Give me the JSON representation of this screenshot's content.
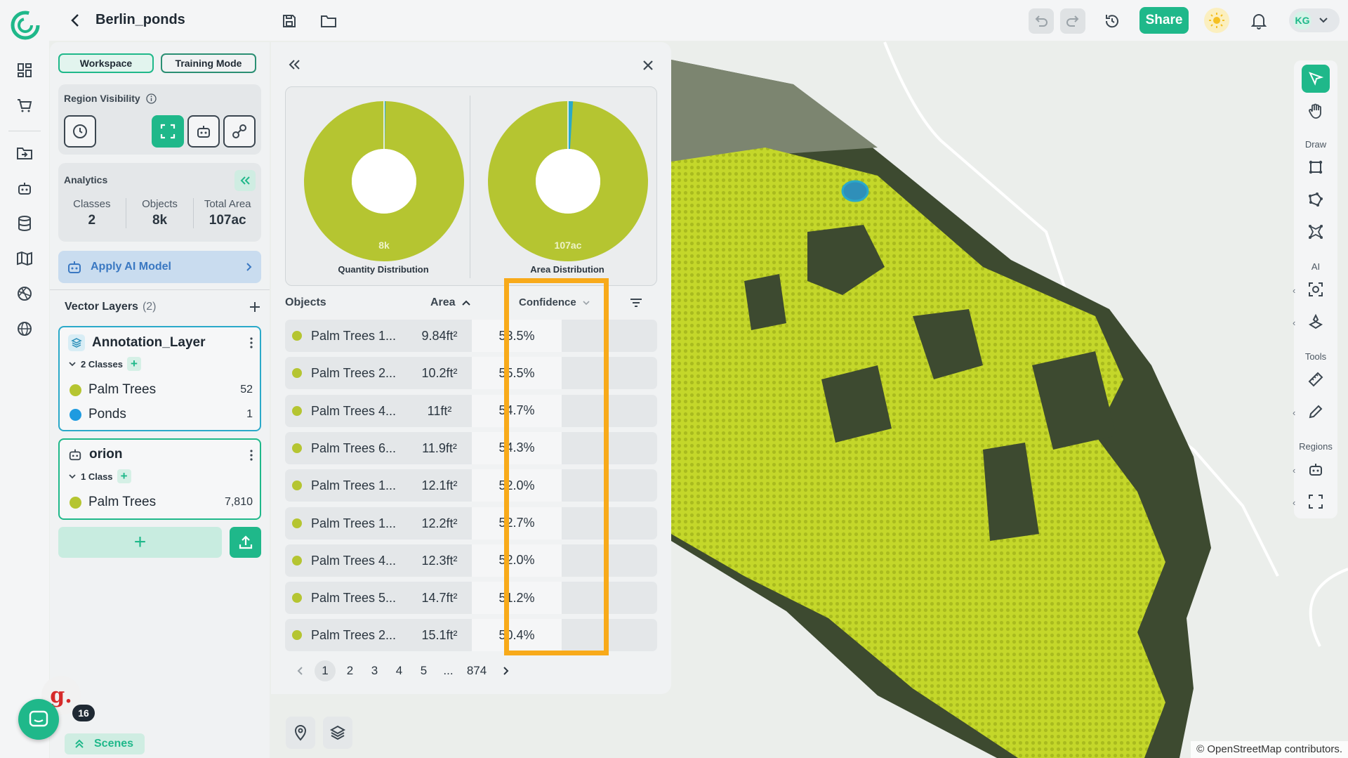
{
  "project": {
    "title": "Berlin_ponds"
  },
  "toolbar": {
    "share_label": "Share",
    "user_initials": "KG"
  },
  "icons": {
    "logo": "logo-icon",
    "back": "chevron-left-icon",
    "save": "save-icon",
    "folder": "folder-icon",
    "undo": "undo-icon",
    "redo": "redo-icon",
    "history": "history-icon",
    "theme": "sun-icon",
    "notifications": "bell-icon",
    "user_menu": "chevron-down-icon"
  },
  "rail": {
    "items": [
      "dashboard-icon",
      "cart-icon",
      "folder-import-icon",
      "robot-icon",
      "database-icon",
      "map-icon",
      "globe-grid-icon",
      "globe-icon"
    ]
  },
  "panel": {
    "modes": [
      {
        "label": "Workspace",
        "active": true
      },
      {
        "label": "Training Mode",
        "active": false
      }
    ],
    "region_visibility": {
      "label": "Region Visibility"
    },
    "analytics": {
      "label": "Analytics",
      "stats": [
        {
          "label": "Classes",
          "value": "2"
        },
        {
          "label": "Objects",
          "value": "8k"
        },
        {
          "label": "Total Area",
          "value": "107ac"
        }
      ]
    },
    "apply_ai": {
      "label": "Apply AI Model"
    },
    "vector_layers": {
      "title": "Vector Layers",
      "count": "(2)",
      "layers": [
        {
          "name": "Annotation_Layer",
          "classes_label": "2 Classes",
          "classes": [
            {
              "name": "Palm Trees",
              "count": "52",
              "color": "#b5c531"
            },
            {
              "name": "Ponds",
              "count": "1",
              "color": "#1e9be0"
            }
          ]
        },
        {
          "name": "orion",
          "classes_label": "1 Class",
          "classes": [
            {
              "name": "Palm Trees",
              "count": "7,810",
              "color": "#b5c531"
            }
          ]
        }
      ]
    },
    "scenes_label": "Scenes"
  },
  "chat": {
    "badge": "g.",
    "count": "16"
  },
  "analytics_table": {
    "charts": [
      {
        "caption": "Quantity Distribution",
        "center_label": "8k",
        "fraction_secondary": 0.003
      },
      {
        "caption": "Area Distribution",
        "center_label": "107ac",
        "fraction_secondary": 0.01
      }
    ],
    "colors": {
      "primary": "#b5c531",
      "secondary": "#2aa9c9",
      "highlight": "#f8aa1a"
    },
    "columns": {
      "objects": "Objects",
      "area": "Area",
      "confidence": "Confidence"
    },
    "rows": [
      {
        "name": "Palm Trees 1...",
        "area": "9.84ft²",
        "confidence": "53.5%"
      },
      {
        "name": "Palm Trees 2...",
        "area": "10.2ft²",
        "confidence": "55.5%"
      },
      {
        "name": "Palm Trees 4...",
        "area": "11ft²",
        "confidence": "54.7%"
      },
      {
        "name": "Palm Trees 6...",
        "area": "11.9ft²",
        "confidence": "54.3%"
      },
      {
        "name": "Palm Trees 1...",
        "area": "12.1ft²",
        "confidence": "52.0%"
      },
      {
        "name": "Palm Trees 1...",
        "area": "12.2ft²",
        "confidence": "52.7%"
      },
      {
        "name": "Palm Trees 4...",
        "area": "12.3ft²",
        "confidence": "52.0%"
      },
      {
        "name": "Palm Trees 5...",
        "area": "14.7ft²",
        "confidence": "51.2%"
      },
      {
        "name": "Palm Trees 2...",
        "area": "15.1ft²",
        "confidence": "50.4%"
      }
    ],
    "pagination": {
      "pages": [
        "1",
        "2",
        "3",
        "4",
        "5",
        "...",
        "874"
      ],
      "current": "1"
    }
  },
  "right_tools": {
    "sections": {
      "draw": "Draw",
      "ai": "AI",
      "tools": "Tools",
      "regions": "Regions"
    }
  },
  "map": {
    "attribution": "© OpenStreetMap contributors."
  }
}
